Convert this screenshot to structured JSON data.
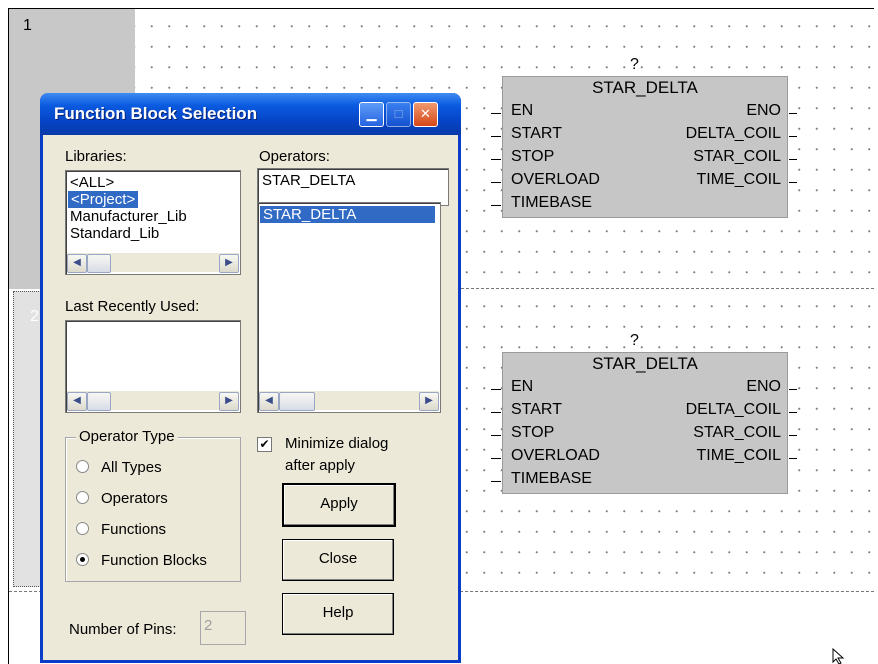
{
  "editor": {
    "rungs": [
      {
        "number": "1"
      },
      {
        "number": "2"
      }
    ],
    "function_blocks": [
      {
        "instance": "?",
        "type": "STAR_DELTA",
        "inputs": [
          "EN",
          "START",
          "STOP",
          "OVERLOAD",
          "TIMEBASE"
        ],
        "outputs": [
          "ENO",
          "DELTA_COIL",
          "STAR_COIL",
          "TIME_COIL"
        ]
      },
      {
        "instance": "?",
        "type": "STAR_DELTA",
        "inputs": [
          "EN",
          "START",
          "STOP",
          "OVERLOAD",
          "TIMEBASE"
        ],
        "outputs": [
          "ENO",
          "DELTA_COIL",
          "STAR_COIL",
          "TIME_COIL"
        ]
      }
    ]
  },
  "dialog": {
    "title": "Function Block Selection",
    "title_buttons": [
      "minimize-icon",
      "maximize-icon",
      "close-icon"
    ],
    "libraries": {
      "label": "Libraries:",
      "items": [
        "<ALL>",
        "<Project>",
        "Manufacturer_Lib",
        "Standard_Lib"
      ],
      "selected": "<Project>"
    },
    "last_recently_used": {
      "label": "Last Recently Used:",
      "items": []
    },
    "operators": {
      "label": "Operators:",
      "filter_value": "STAR_DELTA",
      "items": [
        "STAR_DELTA"
      ],
      "selected": "STAR_DELTA"
    },
    "operator_type": {
      "label": "Operator Type",
      "options": [
        "All Types",
        "Operators",
        "Functions",
        "Function Blocks"
      ],
      "selected": "Function Blocks"
    },
    "minimize_dialog": {
      "label_line1": "Minimize dialog",
      "label_line2": "after apply",
      "checked": true
    },
    "buttons": {
      "apply": "Apply",
      "close": "Close",
      "help": "Help"
    },
    "number_of_pins": {
      "label": "Number of Pins:",
      "value": "2"
    }
  },
  "colors": {
    "titlebar": "#0a5ae0",
    "selection": "#316ac5",
    "dialog_face": "#ece9d8",
    "block_fill": "#c6c6c6",
    "rung_gutter": "#c8c8c8"
  }
}
